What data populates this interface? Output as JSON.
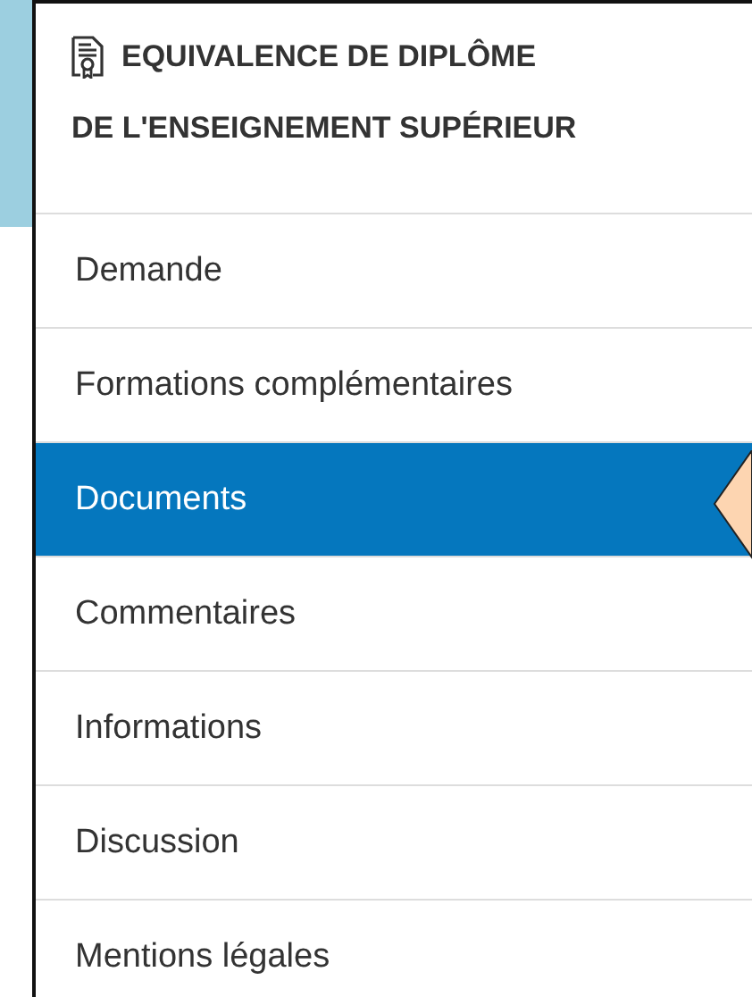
{
  "header": {
    "title_lines": [
      "EQUIVALENCE DE DIPLÔME",
      "DE L'ENSEIGNEMENT SUPÉRIEUR"
    ]
  },
  "menu": [
    {
      "label": "Demande",
      "selected": false
    },
    {
      "label": "Formations complémentaires",
      "selected": false
    },
    {
      "label": "Documents",
      "selected": true
    },
    {
      "label": "Commentaires",
      "selected": false
    },
    {
      "label": "Informations",
      "selected": false
    },
    {
      "label": "Discussion",
      "selected": false
    },
    {
      "label": "Mentions légales",
      "selected": false
    }
  ]
}
